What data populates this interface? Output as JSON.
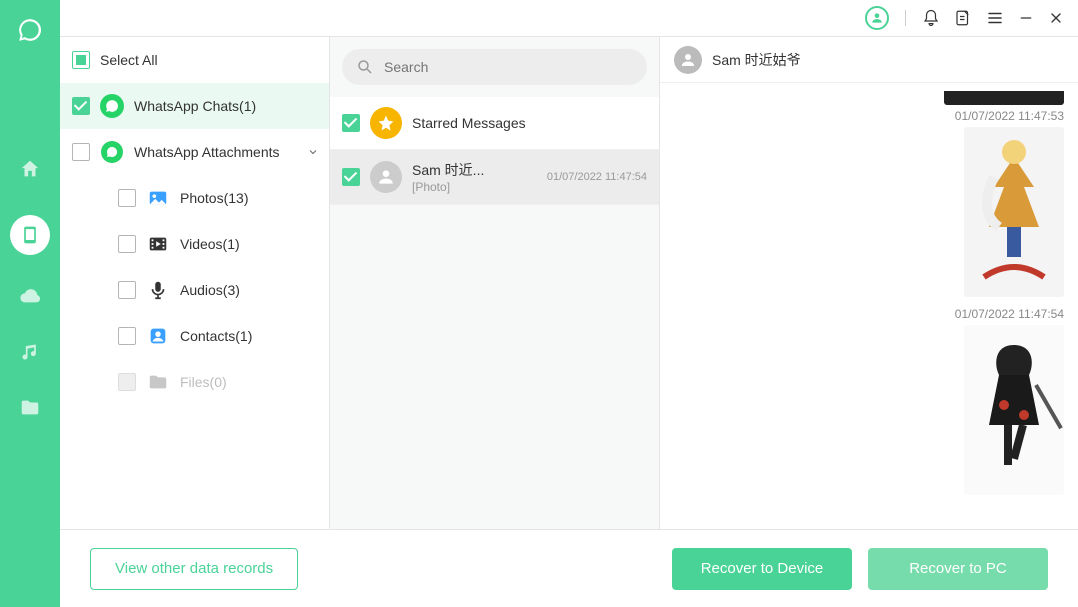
{
  "rail": {
    "items": [
      "home",
      "device",
      "cloud",
      "music",
      "folder"
    ],
    "active_index": 1
  },
  "topbar": {
    "icons": [
      "avatar",
      "bell",
      "note",
      "menu",
      "minimize",
      "close"
    ]
  },
  "tree": {
    "select_all_label": "Select All",
    "chats_label": "WhatsApp Chats(1)",
    "attachments_label": "WhatsApp Attachments",
    "children": [
      {
        "key": "photos",
        "label": "Photos(13)"
      },
      {
        "key": "videos",
        "label": "Videos(1)"
      },
      {
        "key": "audios",
        "label": "Audios(3)"
      },
      {
        "key": "contacts",
        "label": "Contacts(1)"
      },
      {
        "key": "files",
        "label": "Files(0)",
        "disabled": true
      }
    ]
  },
  "search": {
    "placeholder": "Search"
  },
  "chat_list": {
    "items": [
      {
        "title": "Starred Messages",
        "type": "starred"
      },
      {
        "title": "Sam 时近...",
        "sub": "[Photo]",
        "ts": "01/07/2022 11:47:54",
        "type": "chat",
        "selected": true
      }
    ]
  },
  "conversation": {
    "header_name": "Sam 时近姑爷",
    "messages": [
      {
        "ts": "01/07/2022 11:47:53",
        "type": "photo"
      },
      {
        "ts": "01/07/2022 11:47:54",
        "type": "photo"
      }
    ]
  },
  "footer": {
    "view_records": "View other data records",
    "recover_device": "Recover to Device",
    "recover_pc": "Recover to PC"
  },
  "colors": {
    "accent": "#4ad397"
  }
}
